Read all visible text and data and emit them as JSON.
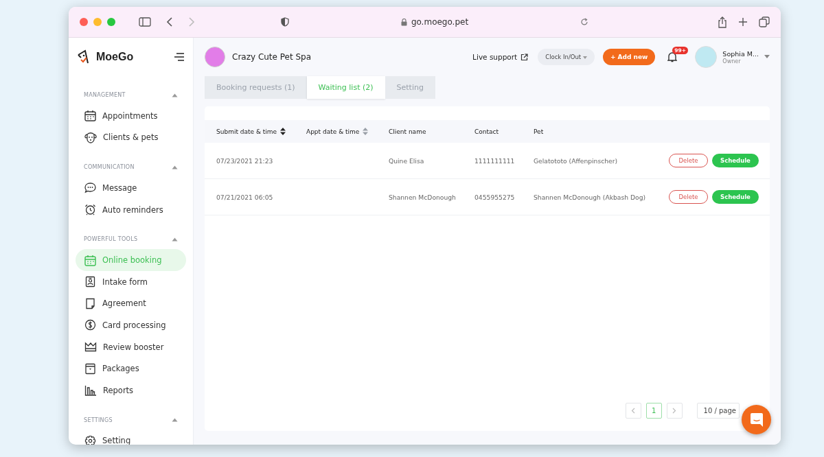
{
  "browser": {
    "url": "go.moego.pet"
  },
  "sidebar": {
    "logo": "MoeGo",
    "sections": [
      {
        "title": "MANAGEMENT",
        "expanded": true,
        "items": [
          {
            "label": "Appointments",
            "kind": "calendar",
            "selected": false
          },
          {
            "label": "Clients & pets",
            "kind": "dog",
            "selected": false
          }
        ]
      },
      {
        "title": "COMMUNICATION",
        "expanded": true,
        "items": [
          {
            "label": "Message",
            "kind": "chat",
            "selected": false
          },
          {
            "label": "Auto reminders",
            "kind": "alarm",
            "selected": false
          }
        ]
      },
      {
        "title": "POWERFUL TOOLS",
        "expanded": true,
        "items": [
          {
            "label": "Online booking",
            "kind": "calendar",
            "selected": true
          },
          {
            "label": "Intake form",
            "kind": "badge",
            "selected": false
          },
          {
            "label": "Agreement",
            "kind": "document",
            "selected": false
          },
          {
            "label": "Card processing",
            "kind": "dollar",
            "selected": false
          },
          {
            "label": "Review booster",
            "kind": "crown",
            "selected": false
          },
          {
            "label": "Packages",
            "kind": "box",
            "selected": false
          },
          {
            "label": "Reports",
            "kind": "chart",
            "selected": false
          }
        ]
      },
      {
        "title": "SETTINGS",
        "expanded": true,
        "items": [
          {
            "label": "Setting",
            "kind": "gear",
            "selected": false
          }
        ]
      }
    ]
  },
  "header": {
    "business": "Crazy Cute Pet Spa",
    "live_support": "Live support",
    "clock": "Clock In/Out",
    "add_new": "+ Add new",
    "notifications": "99+",
    "user": {
      "name": "Sophia M...",
      "role": "Owner"
    }
  },
  "tabs": [
    {
      "label": "Booking requests (1)",
      "selected": false
    },
    {
      "label": "Waiting list (2)",
      "selected": true
    },
    {
      "label": "Setting",
      "selected": false
    }
  ],
  "table": {
    "columns": [
      {
        "label": "Submit date & time",
        "sortable": true
      },
      {
        "label": "Appt date & time",
        "sortable": true
      },
      {
        "label": "Client name",
        "sortable": false
      },
      {
        "label": "Contact",
        "sortable": false
      },
      {
        "label": "Pet",
        "sortable": false
      }
    ],
    "rows": [
      {
        "submitted": "07/23/2021 21:23",
        "client": "Quine Elisa",
        "contact": "1111111111",
        "pet": "Gelatototo (Affenpinscher)",
        "delete": "Delete",
        "schedule": "Schedule"
      },
      {
        "submitted": "07/21/2021 06:05",
        "client": "Shannen McDonough",
        "contact": "0455955275",
        "pet": "Shannen McDonough (Akbash Dog)",
        "delete": "Delete",
        "schedule": "Schedule"
      }
    ]
  },
  "pagination": {
    "pages": [
      {
        "label": "1",
        "selected": true
      }
    ],
    "page_size": "10 / page"
  }
}
